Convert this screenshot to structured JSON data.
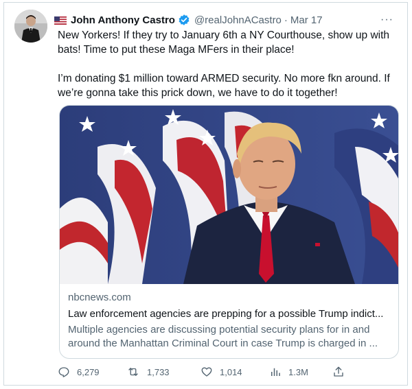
{
  "author": {
    "display_name": "John Anthony Castro",
    "handle": "@realJohnACastro",
    "separator": "·",
    "date": "Mar 17",
    "more_label": "···",
    "flag_icon": "us-flag-icon",
    "verified_icon": "verified-badge-icon",
    "verified_color": "#1d9bf0"
  },
  "tweet": {
    "paragraph_1": "New Yorkers! If they try to January 6th a NY Courthouse, show up with bats! Time to put these Maga MFers in their place!",
    "paragraph_2": "I’m donating $1 million toward ARMED security. No more fkn around. If we’re gonna take this prick down, we have to do it together!"
  },
  "link_card": {
    "domain": "nbcnews.com",
    "title": "Law enforcement agencies are prepping for a possible Trump indict...",
    "description": "Multiple agencies are discussing potential security plans for in and around the Manhattan Criminal Court in case Trump is charged in ..."
  },
  "actions": {
    "replies": "6,279",
    "retweets": "1,733",
    "likes": "1,014",
    "views": "1.3M",
    "icons": [
      "reply-icon",
      "retweet-icon",
      "like-icon",
      "views-icon",
      "share-icon"
    ]
  },
  "colors": {
    "text": "#0f1419",
    "secondary": "#536471",
    "border": "#cfd9de"
  }
}
